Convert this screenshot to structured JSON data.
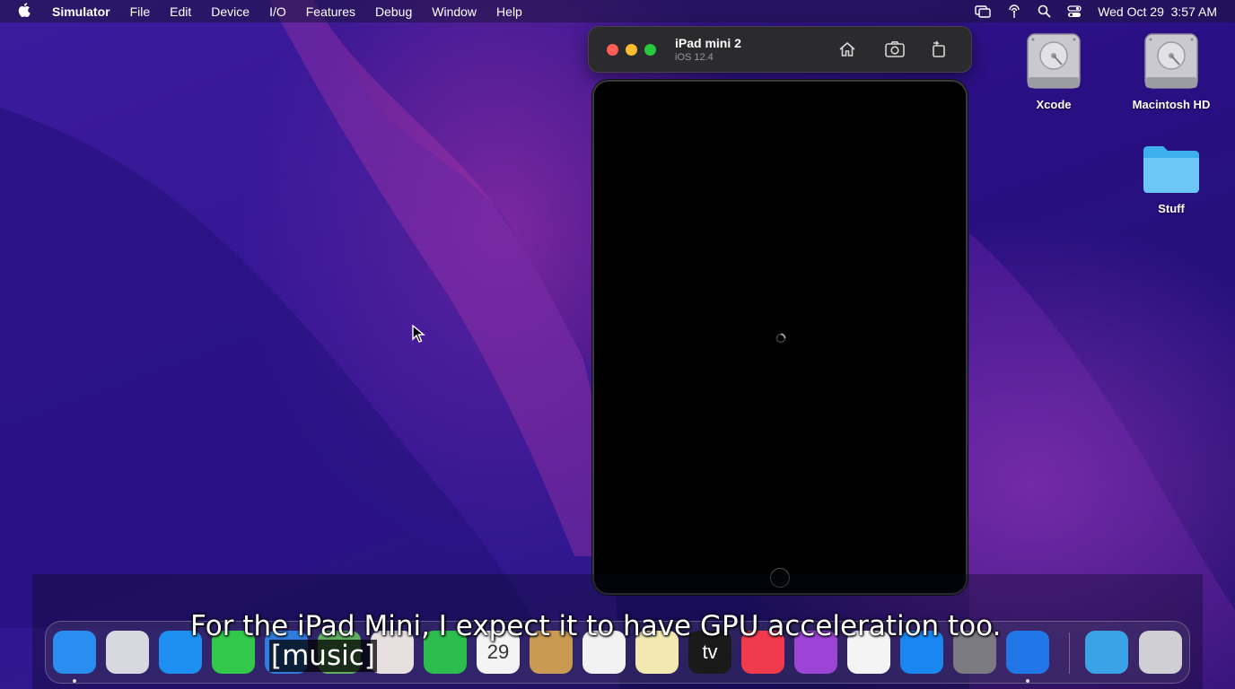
{
  "menubar": {
    "apple_icon": "apple-logo-icon",
    "app_name": "Simulator",
    "items": [
      "File",
      "Edit",
      "Device",
      "I/O",
      "Features",
      "Debug",
      "Window",
      "Help"
    ],
    "status_icons": [
      "screen-mirroring-icon",
      "airdrop-icon",
      "search-icon",
      "control-center-icon"
    ],
    "datetime": "Wed Oct 29  3:57 AM"
  },
  "simulator": {
    "device_name": "iPad mini 2",
    "os_version": "iOS 12.4",
    "toolbar_icons": [
      "home-icon",
      "screenshot-icon",
      "rotate-icon"
    ],
    "screen_state": "loading",
    "screen_color": "#000000"
  },
  "desktop": {
    "icons": [
      {
        "label": "Xcode",
        "icon": "hard-drive-icon"
      },
      {
        "label": "Macintosh HD",
        "icon": "hard-drive-icon"
      },
      {
        "label": "Stuff",
        "icon": "folder-icon"
      }
    ]
  },
  "dock": {
    "apps": [
      {
        "name": "finder",
        "color": "#2a8df0"
      },
      {
        "name": "launchpad",
        "color": "#d8d8e0"
      },
      {
        "name": "safari",
        "color": "#1e8ff2"
      },
      {
        "name": "messages",
        "color": "#32c84a"
      },
      {
        "name": "mail",
        "color": "#2f7de0"
      },
      {
        "name": "maps",
        "color": "#60b060"
      },
      {
        "name": "photos",
        "color": "#e8e0e0"
      },
      {
        "name": "facetime",
        "color": "#2dbd4e"
      },
      {
        "name": "calendar",
        "color": "#f4f4f4",
        "label": "29"
      },
      {
        "name": "contacts",
        "color": "#c89a52"
      },
      {
        "name": "reminders",
        "color": "#f2f2f2"
      },
      {
        "name": "notes",
        "color": "#f3e9b0"
      },
      {
        "name": "tv",
        "color": "#1a1a1a",
        "label": "tv"
      },
      {
        "name": "music",
        "color": "#f23a4e"
      },
      {
        "name": "podcasts",
        "color": "#9b44d6"
      },
      {
        "name": "news",
        "color": "#f4f4f4"
      },
      {
        "name": "app-store",
        "color": "#1a86f0"
      },
      {
        "name": "system-preferences",
        "color": "#7a7a80"
      },
      {
        "name": "xcode",
        "color": "#2277e8"
      }
    ],
    "extras": [
      {
        "name": "downloads-folder",
        "color": "#3aa2e6"
      },
      {
        "name": "trash",
        "color": "#cfcfd4"
      }
    ]
  },
  "captions": {
    "line1": "For the iPad Mini, I expect it to have GPU acceleration too.",
    "line2": "[music]"
  }
}
